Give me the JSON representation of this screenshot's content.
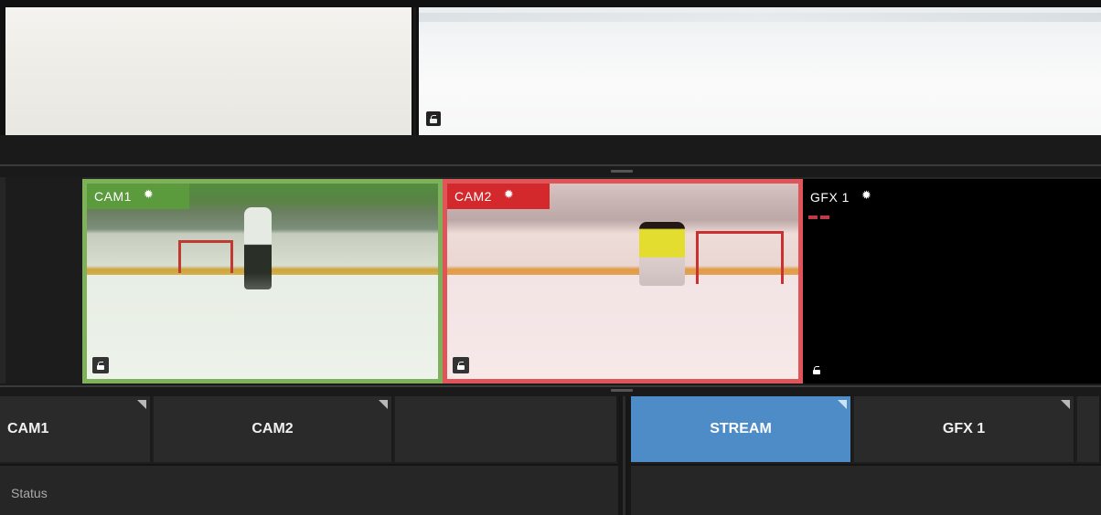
{
  "sources": {
    "cam1": {
      "label": "CAM1",
      "tally": "preview",
      "color": "#7fb15a"
    },
    "cam2": {
      "label": "CAM2",
      "tally": "program",
      "color": "#e05559"
    },
    "gfx1": {
      "label": "GFX 1"
    }
  },
  "buttons": {
    "cam1": "CAM1",
    "cam2": "CAM2",
    "empty": "",
    "stream": "STREAM",
    "gfx1": "GFX 1"
  },
  "status": {
    "label": "Status"
  },
  "colors": {
    "stream_active": "#4d8cc6",
    "preview_tally": "#7fb15a",
    "program_tally": "#e05559"
  }
}
